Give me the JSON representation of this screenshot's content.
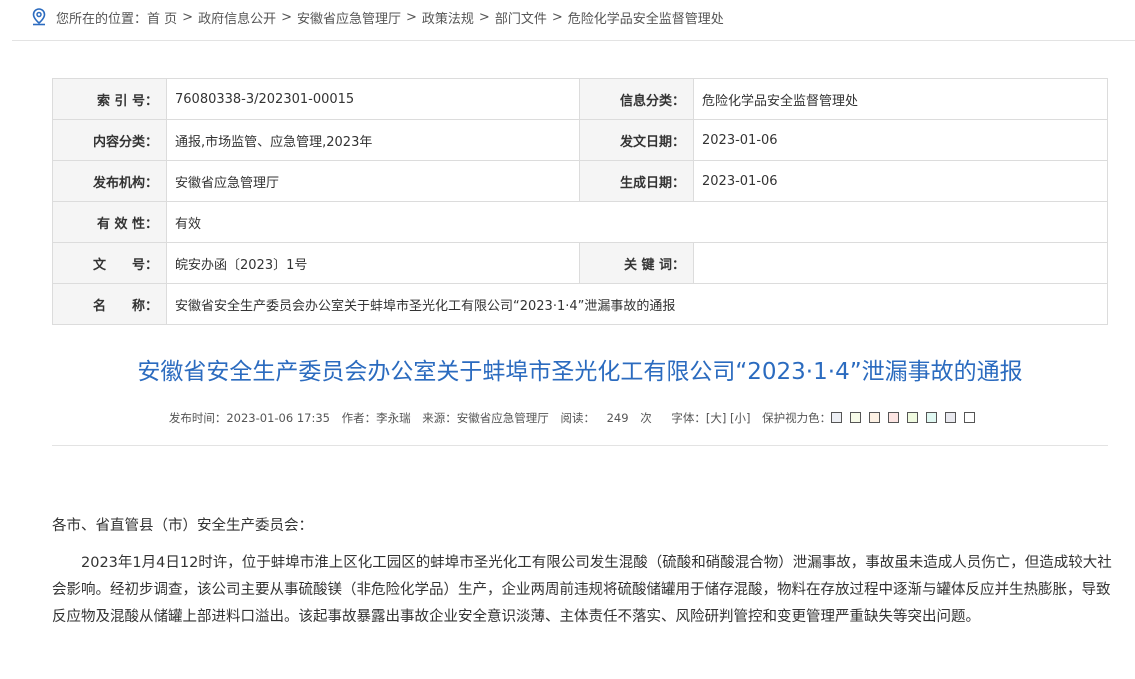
{
  "breadcrumb": {
    "prefix": "您所在的位置：",
    "items": [
      "首 页",
      "政府信息公开",
      "安徽省应急管理厅",
      "政策法规",
      "部门文件",
      "危险化学品安全监督管理处"
    ],
    "separator": ">"
  },
  "meta": {
    "index_label": "索 引 号：",
    "index": "76080338-3/202301-00015",
    "info_cat_label": "信息分类：",
    "info_cat": "危险化学品安全监督管理处",
    "content_cat_label": "内容分类：",
    "content_cat": "通报,市场监管、应急管理,2023年",
    "issue_date_label": "发文日期：",
    "issue_date": "2023-01-06",
    "publisher_label": "发布机构：",
    "publisher": "安徽省应急管理厅",
    "gen_date_label": "生成日期：",
    "gen_date": "2023-01-06",
    "validity_label": "有 效 性：",
    "validity": "有效",
    "doc_no_label": "文　　号：",
    "doc_no": "皖安办函〔2023〕1号",
    "keywords_label": "关 键 词：",
    "keywords": "",
    "name_label": "名　　称：",
    "name": "安徽省安全生产委员会办公室关于蚌埠市圣光化工有限公司“2023·1·4”泄漏事故的通报"
  },
  "article": {
    "title": "安徽省安全生产委员会办公室关于蚌埠市圣光化工有限公司“2023·1·4”泄漏事故的通报",
    "publish_time": "发布时间：2023-01-06 17:35",
    "author": "作者：李永瑞",
    "source": "来源：安徽省应急管理厅",
    "reads_label": "阅读：",
    "reads": "249",
    "reads_unit": "次",
    "font_label": "字体：",
    "font_large": "[大]",
    "font_small": "[小]",
    "eye_label": "保护视力色：",
    "eye_colors": [
      "#eef0f5",
      "#f7fbe9",
      "#fdf1e4",
      "#fde5e3",
      "#f0fbe0",
      "#e0f8f2",
      "#e9e9ef",
      "#ffffff"
    ],
    "salutation": "各市、省直管县（市）安全生产委员会：",
    "paragraph1": "2023年1月4日12时许，位于蚌埠市淮上区化工园区的蚌埠市圣光化工有限公司发生混酸（硫酸和硝酸混合物）泄漏事故，事故虽未造成人员伤亡，但造成较大社会影响。经初步调查，该公司主要从事硫酸镁（非危险化学品）生产，企业两周前违规将硫酸储罐用于储存混酸，物料在存放过程中逐渐与罐体反应并生热膨胀，导致反应物及混酸从储罐上部进料口溢出。该起事故暴露出事故企业安全意识淡薄、主体责任不落实、风险研判管控和变更管理严重缺失等突出问题。"
  }
}
